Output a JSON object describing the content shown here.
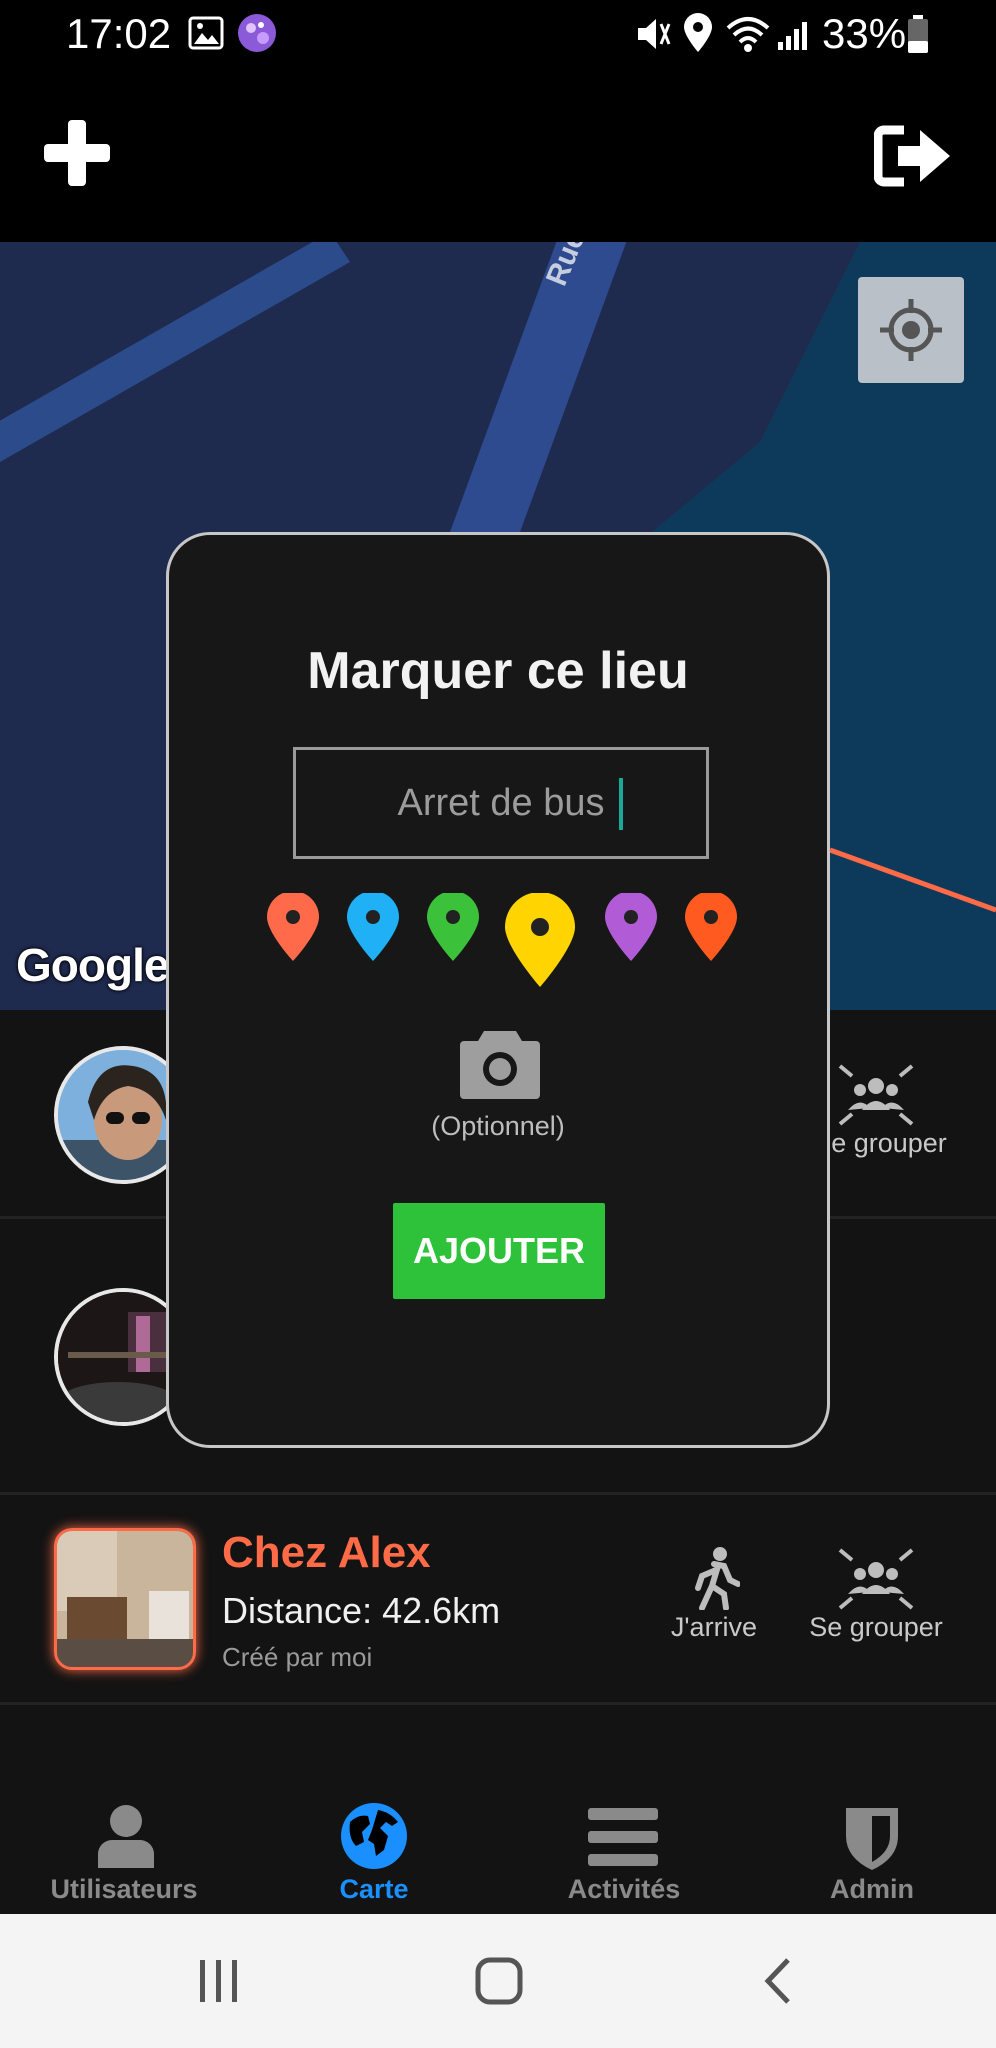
{
  "status_bar": {
    "time": "17:02",
    "battery": "33%",
    "icons": [
      "gallery-icon",
      "app-notification-icon",
      "mute-icon",
      "location-icon",
      "wifi-icon",
      "signal-icon",
      "battery-icon"
    ]
  },
  "app_bar": {
    "left_icon": "plus-icon",
    "right_icon": "logout-icon"
  },
  "map": {
    "street_label": "Rue d",
    "attribution": "Google",
    "locate_icon": "crosshair-icon"
  },
  "dialog": {
    "title": "Marquer ce lieu",
    "input_value": "Arret de bus",
    "pin_colors": [
      "#ff6b4a",
      "#1fb0f5",
      "#3cc23a",
      "#ffd400",
      "#b25bd6",
      "#ff5a1f"
    ],
    "selected_pin_index": 3,
    "camera_icon": "camera-icon",
    "optional_label": "(Optionnel)",
    "add_button": "AJOUTER"
  },
  "list": {
    "items": [
      {
        "action_label": "Se grouper"
      },
      {},
      {
        "name": "Chez Alex",
        "distance": "Distance: 42.6km",
        "creator": "Créé par moi",
        "action_arrive": "J'arrive",
        "action_group": "Se grouper"
      }
    ]
  },
  "colors": {
    "accent": "#1a8fff",
    "place_name": "#ff6a47",
    "add_button": "#2ec13a"
  },
  "bottom_nav": {
    "items": [
      {
        "label": "Utilisateurs",
        "icon": "user-icon"
      },
      {
        "label": "Carte",
        "icon": "globe-icon",
        "active": true
      },
      {
        "label": "Activités",
        "icon": "menu-icon"
      },
      {
        "label": "Admin",
        "icon": "shield-icon"
      }
    ]
  },
  "system_nav": {
    "icons": [
      "recents-icon",
      "home-icon",
      "back-icon"
    ]
  }
}
